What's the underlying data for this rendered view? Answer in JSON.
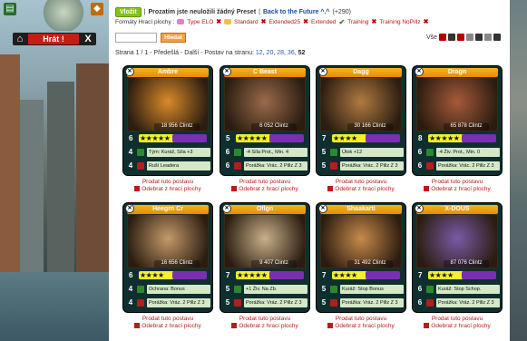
{
  "game_panel": {
    "play_label": "Hrát !",
    "close_label": "X",
    "home_label": "⌂"
  },
  "header": {
    "button_label": "Vložit",
    "notice": "Prozatím jste neuložili žádný Preset",
    "back_link": "Back to the Future ^.^",
    "count": "(+290)",
    "formats_label": "Formáty Hrací plochy :",
    "formats": [
      {
        "name": "Type ELO",
        "state": "x"
      },
      {
        "name": "Standard",
        "state": "x"
      },
      {
        "name": "Extended25",
        "state": "x"
      },
      {
        "name": "Extended",
        "state": "v"
      },
      {
        "name": "Training",
        "state": "x"
      },
      {
        "name": "Training NoPillz",
        "state": "x"
      }
    ]
  },
  "search": {
    "placeholder": "",
    "button_label": "Hledat",
    "filter_label": "Vše"
  },
  "pager": {
    "text": "Strana 1 / 1 - Předešlá - Další - Postav na stranu:",
    "pages": [
      "12",
      "20",
      "28",
      "36",
      "52"
    ]
  },
  "cards": [
    {
      "name": "Ambre",
      "clintz": "18 956 Clintz",
      "level": "6",
      "stars": "★★★★★",
      "row1_num": "4",
      "row1": "Tým: Kuráž, Síla +3",
      "row2_num": "4",
      "row2": "Ruší Leadera",
      "art_color": "#d98a2a"
    },
    {
      "name": "C Beast",
      "clintz": "6 052 Clintz",
      "level": "5",
      "stars": "★★★★★",
      "row1_num": "6",
      "row1": "-4 Síla Prot., Min. 4",
      "row2_num": "6",
      "row2": "Porážka: Vrác. 2 Pillz Z 3",
      "art_color": "#9a6a4a"
    },
    {
      "name": "Dagg",
      "clintz": "30 166 Clintz",
      "level": "7",
      "stars": "★★★★",
      "row1_num": "5",
      "row1": "Útok +12",
      "row2_num": "5",
      "row2": "Porážka: Vrác. 2 Pillz Z 3",
      "art_color": "#b07a40"
    },
    {
      "name": "Dragn",
      "clintz": "65 878 Clintz",
      "level": "8",
      "stars": "★★★★★",
      "row1_num": "6",
      "row1": "-4 Živ. Prot., Min. 0",
      "row2_num": "6",
      "row2": "Porážka: Vrác. 2 Pillz Z 3",
      "art_color": "#a65a3a"
    },
    {
      "name": "Heegrn Cr",
      "clintz": "16 656 Clintz",
      "level": "6",
      "stars": "★★★★",
      "row1_num": "4",
      "row1": "Ochrana: Bonus",
      "row2_num": "4",
      "row2": "Porážka: Vráz. 2 Pillz Z 3",
      "art_color": "#c59a6a"
    },
    {
      "name": "Oflgn",
      "clintz": "9 407 Clintz",
      "level": "7",
      "stars": "★★★★★",
      "row1_num": "5",
      "row1": "+1 Živ. Na Zb.",
      "row2_num": "5",
      "row2": "Porážka: Vráz. 2 Pillz Z 3",
      "art_color": "#c9b08a"
    },
    {
      "name": "Shaakarti",
      "clintz": "31 492 Clintz",
      "level": "7",
      "stars": "★★★★",
      "row1_num": "5",
      "row1": "Kuráž: Stop Bonus",
      "row2_num": "5",
      "row2": "Porážka: Vráz. 2 Pillz Z 3",
      "art_color": "#c88a4a"
    },
    {
      "name": "X-DOUS",
      "clintz": "87 076 Clintz",
      "level": "7",
      "stars": "★★★★",
      "row1_num": "6",
      "row1": "Kuráž: Stop Schop.",
      "row2_num": "6",
      "row2": "Porážka: Vráz. 2 Pillz Z 3",
      "art_color": "#7a5aa6"
    }
  ],
  "card_actions": {
    "sell": "Prodat tuto postavu",
    "remove": "Odebrat z hrací plochy"
  },
  "colors": {
    "accent_green": "#84c21b",
    "card_frame": "#0f2f2f",
    "link_red": "#b41d1d"
  }
}
